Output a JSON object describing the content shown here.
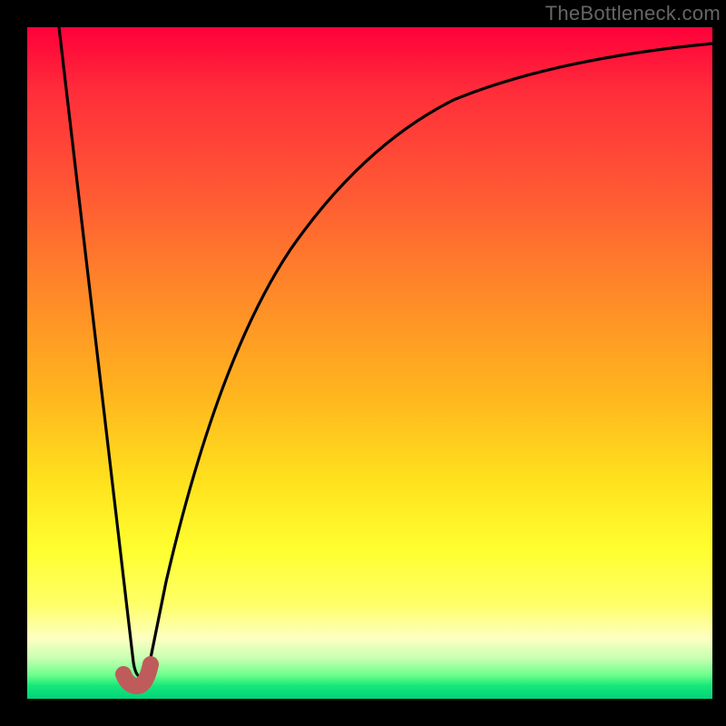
{
  "watermark": "TheBottleneck.com",
  "chart_data": {
    "type": "line",
    "title": "",
    "xlabel": "",
    "ylabel": "",
    "xlim": [
      0,
      100
    ],
    "ylim": [
      0,
      100
    ],
    "grid": false,
    "legend": false,
    "series": [
      {
        "name": "curve",
        "x": [
          0,
          5,
          10,
          13,
          15,
          17,
          20,
          25,
          30,
          35,
          40,
          45,
          50,
          55,
          60,
          70,
          80,
          90,
          100
        ],
        "y": [
          100,
          70,
          40,
          20,
          4,
          4,
          20,
          40,
          55,
          65,
          73,
          79,
          83,
          86,
          88,
          91,
          93,
          94.5,
          95
        ]
      }
    ],
    "marker": {
      "name": "highlighted-range",
      "x": [
        13.5,
        14.5,
        16,
        17.5
      ],
      "y": [
        3.8,
        2.2,
        2.2,
        5.5
      ]
    },
    "colors": {
      "curve": "#000000",
      "marker": "#c05b5b",
      "gradient_top": "#ff003a",
      "gradient_bottom": "#00d47a",
      "background": "#000000"
    }
  }
}
